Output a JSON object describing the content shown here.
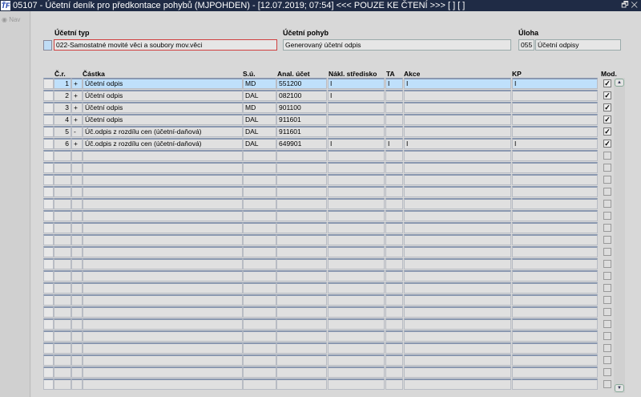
{
  "window": {
    "title": "05107 - Účetní deník pro předkontace pohybů (MJPOHDEN) - [12.07.2019; 07:54] <<< POUZE KE ČTENÍ >>>  [ ]  [ ]",
    "logo": "ŤF",
    "controls": "🗗 ✕"
  },
  "sidebar": {
    "nav_label": "Nav"
  },
  "header": {
    "ucetni_typ_label": "Účetní typ",
    "ucetni_typ_value": "022-Samostatné movité věci a soubory mov.věci",
    "ucetni_pohyb_label": "Účetní pohyb",
    "ucetni_pohyb_value": "Generovaný účetní odpis",
    "uloha_label": "Úloha",
    "uloha_code": "055",
    "uloha_name": "Účetní odpisy"
  },
  "table": {
    "columns": {
      "cr": "Č.r.",
      "castka": "Částka",
      "su": "S.ú.",
      "anal": "Anal. účet",
      "nakl": "Nákl. středisko",
      "ta": "TA",
      "akce": "Akce",
      "kp": "KP",
      "mod": "Mod."
    },
    "rows": [
      {
        "cr": "1",
        "sign": "+",
        "castka": "Účetní odpis",
        "su": "MD",
        "anal": "551200",
        "nakl": "I",
        "ta": "I",
        "akce": "I",
        "kp": "I",
        "mod": true
      },
      {
        "cr": "2",
        "sign": "+",
        "castka": "Účetní odpis",
        "su": "DAL",
        "anal": "082100",
        "nakl": "I",
        "ta": "",
        "akce": "",
        "kp": "",
        "mod": true
      },
      {
        "cr": "3",
        "sign": "+",
        "castka": "Účetní odpis",
        "su": "MD",
        "anal": "901100",
        "nakl": "",
        "ta": "",
        "akce": "",
        "kp": "",
        "mod": true
      },
      {
        "cr": "4",
        "sign": "+",
        "castka": "Účetní odpis",
        "su": "DAL",
        "anal": "911601",
        "nakl": "",
        "ta": "",
        "akce": "",
        "kp": "",
        "mod": true
      },
      {
        "cr": "5",
        "sign": "-",
        "castka": "Úč.odpis z rozdílu cen (účetní-daňová)",
        "su": "DAL",
        "anal": "911601",
        "nakl": "",
        "ta": "",
        "akce": "",
        "kp": "",
        "mod": true
      },
      {
        "cr": "6",
        "sign": "+",
        "castka": "Úč.odpis z rozdílu cen (účetní-daňová)",
        "su": "DAL",
        "anal": "649901",
        "nakl": "I",
        "ta": "I",
        "akce": "I",
        "kp": "I",
        "mod": true
      }
    ],
    "empty_rows": 20,
    "active_row": 0
  }
}
